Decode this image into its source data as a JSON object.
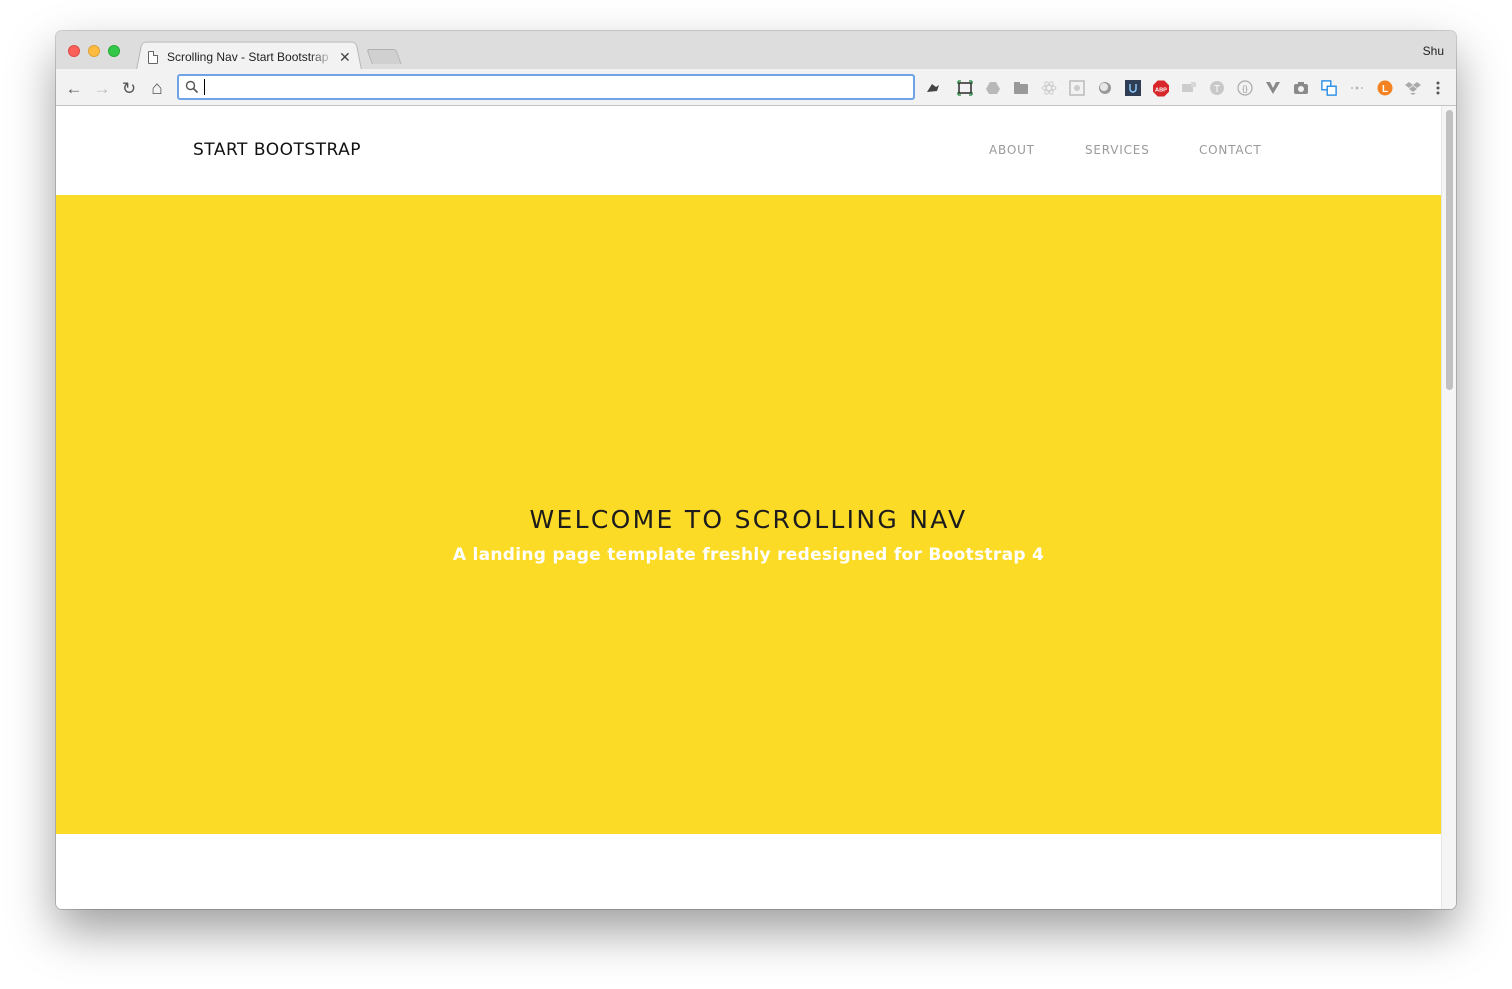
{
  "browser": {
    "tab_title": "Scrolling Nav - Start Bootstrap",
    "tab_close": "✕",
    "profile_name": "Shu",
    "omnibox": {
      "value": "",
      "placeholder": ""
    },
    "nav": {
      "back": "←",
      "forward": "→",
      "reload": "↻",
      "home": "⌂"
    },
    "extensions": [
      {
        "name": "ext-bird-icon"
      },
      {
        "name": "ext-capture-icon"
      },
      {
        "name": "ext-drive-icon"
      },
      {
        "name": "ext-folder-icon"
      },
      {
        "name": "ext-react-icon"
      },
      {
        "name": "ext-grid-icon"
      },
      {
        "name": "ext-circle-icon"
      },
      {
        "name": "ext-u-icon"
      },
      {
        "name": "ext-abp-icon",
        "label": "ABP"
      },
      {
        "name": "ext-tag-icon"
      },
      {
        "name": "ext-t-icon"
      },
      {
        "name": "ext-brackets-icon"
      },
      {
        "name": "ext-vue-icon"
      },
      {
        "name": "ext-camera-icon"
      },
      {
        "name": "ext-translate-icon"
      },
      {
        "name": "ext-dots-icon"
      },
      {
        "name": "ext-l-icon",
        "label": "L"
      },
      {
        "name": "ext-dropbox-icon"
      },
      {
        "name": "browser-menu-icon"
      }
    ]
  },
  "site": {
    "brand": "START BOOTSTRAP",
    "nav_links": [
      "ABOUT",
      "SERVICES",
      "CONTACT"
    ],
    "hero": {
      "title": "WELCOME TO SCROLLING NAV",
      "subtitle": "A landing page template freshly redesigned for Bootstrap 4"
    }
  },
  "colors": {
    "hero_bg": "#fcdb27",
    "omnibox_focus": "#6ea4e6",
    "abp_red": "#d7272a",
    "ext_orange": "#f58220"
  }
}
